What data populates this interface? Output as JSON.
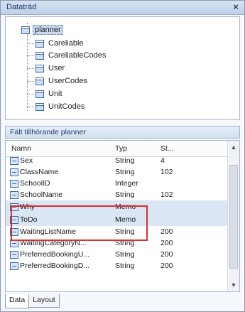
{
  "window": {
    "title": "Dataträd",
    "close_glyph": "×"
  },
  "tree": {
    "items": [
      {
        "label": "planner",
        "selected": true
      },
      {
        "label": "Careliable"
      },
      {
        "label": "CareliableCodes"
      },
      {
        "label": "User"
      },
      {
        "label": "UserCodes"
      },
      {
        "label": "Unit"
      },
      {
        "label": "UnitCodes"
      }
    ]
  },
  "fields": {
    "caption": "Fält tillhörande planner",
    "columns": {
      "name": "Namn",
      "type": "Typ",
      "size": "St..."
    },
    "rows": [
      {
        "name": "Sex",
        "type": "String",
        "size": "4"
      },
      {
        "name": "ClassName",
        "type": "String",
        "size": "102"
      },
      {
        "name": "SchoolID",
        "type": "Integer",
        "size": ""
      },
      {
        "name": "SchoolName",
        "type": "String",
        "size": "102"
      },
      {
        "name": "Why",
        "type": "Memo",
        "size": "",
        "highlight": true
      },
      {
        "name": "ToDo",
        "type": "Memo",
        "size": "",
        "highlight": true
      },
      {
        "name": "WaitingListName",
        "type": "String",
        "size": "200"
      },
      {
        "name": "WaitingCategoryN...",
        "type": "String",
        "size": "200"
      },
      {
        "name": "PreferredBookingU...",
        "type": "String",
        "size": "200"
      },
      {
        "name": "PreferredBookingD...",
        "type": "String",
        "size": "200"
      }
    ]
  },
  "tabs": [
    {
      "label": "Data",
      "active": true
    },
    {
      "label": "Layout"
    }
  ],
  "colors": {
    "highlight_box": "#d63031",
    "selection": "#dbe6f4"
  }
}
